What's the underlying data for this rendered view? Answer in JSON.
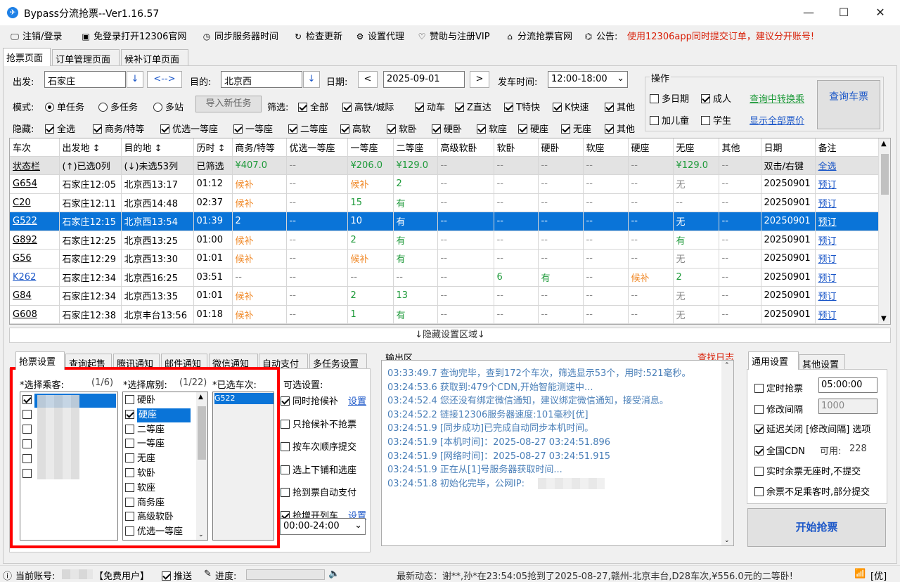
{
  "window": {
    "title": "Bypass分流抢票--Ver1.16.57",
    "app_icon_glyph": "✈"
  },
  "menu": {
    "items": [
      {
        "icon": "🖵",
        "label": "注销/登录"
      },
      {
        "icon": "▣",
        "label": "免登录打开12306官网"
      },
      {
        "icon": "◷",
        "label": "同步服务器时间"
      },
      {
        "icon": "↻",
        "label": "检查更新"
      },
      {
        "icon": "⚙",
        "label": "设置代理"
      },
      {
        "icon": "♡",
        "label": "赞助与注册VIP"
      },
      {
        "icon": "⌂",
        "label": "分流抢票官网"
      },
      {
        "icon": "⌬",
        "label": "公告:"
      }
    ],
    "notice": "使用12306app同时提交订单，建议分开账号!"
  },
  "top_tabs": [
    "抢票页面",
    "订单管理页面",
    "候补订单页面"
  ],
  "query": {
    "from_label": "出发:",
    "from_value": "石家庄",
    "swap_label": "<-->",
    "to_label": "目的:",
    "to_value": "北京西",
    "date_label": "日期:",
    "date_value": "2025-09-01",
    "prev": "<",
    "next": ">",
    "time_label": "发车时间:",
    "time_value": "12:00-18:00",
    "mode_label": "模式:",
    "modes": [
      {
        "label": "单任务",
        "on": true
      },
      {
        "label": "多任务",
        "on": false
      },
      {
        "label": "多站",
        "on": false
      }
    ],
    "import_btn": "导入新任务",
    "filter_label": "筛选:",
    "filters": [
      {
        "label": "全部",
        "on": true
      },
      {
        "label": "高铁/城际",
        "on": true
      },
      {
        "label": "动车",
        "on": true
      },
      {
        "label": "Z直达",
        "on": true
      },
      {
        "label": "T特快",
        "on": true
      },
      {
        "label": "K快速",
        "on": true
      },
      {
        "label": "其他",
        "on": true
      }
    ],
    "hide_label": "隐藏:",
    "hides": [
      {
        "label": "全选",
        "on": true
      },
      {
        "label": "商务/特等",
        "on": true
      },
      {
        "label": "优选一等座",
        "on": true
      },
      {
        "label": "一等座",
        "on": true
      },
      {
        "label": "二等座",
        "on": true
      },
      {
        "label": "高软",
        "on": true
      },
      {
        "label": "软卧",
        "on": true
      },
      {
        "label": "硬卧",
        "on": true
      },
      {
        "label": "软座",
        "on": true
      },
      {
        "label": "硬座",
        "on": true
      },
      {
        "label": "无座",
        "on": true
      },
      {
        "label": "其他",
        "on": true
      }
    ]
  },
  "ops": {
    "title": "操作",
    "multi_day": "多日期",
    "adult": "成人",
    "child": "加儿童",
    "student": "学生",
    "transfer_link": "查询中转换乘",
    "all_price_link": "显示全部票价",
    "query_btn": "查询车票"
  },
  "table": {
    "headers": [
      "车次",
      "出发地 ↕",
      "目的地 ↕",
      "历时 ↕",
      "商务/特等",
      "优选一等座",
      "一等座",
      "二等座",
      "高级软卧",
      "软卧",
      "硬卧",
      "软座",
      "硬座",
      "无座",
      "其他",
      "日期",
      "备注"
    ],
    "status_row": [
      "状态栏",
      "(↑)已选0列",
      "(↓)未选53列",
      "已筛选",
      "¥407.0",
      "--",
      "¥206.0",
      "¥129.0",
      "--",
      "--",
      "--",
      "--",
      "--",
      "¥129.0",
      "--",
      "双击/右键",
      "全选"
    ],
    "rows": [
      [
        "G654",
        "石家庄12:05",
        "北京西13:17",
        "01:12",
        "候补",
        "--",
        "候补",
        "2",
        "--",
        "--",
        "--",
        "--",
        "--",
        "无",
        "--",
        "20250901",
        "预订"
      ],
      [
        "C20",
        "石家庄12:11",
        "北京西14:48",
        "02:37",
        "候补",
        "--",
        "15",
        "有",
        "--",
        "--",
        "--",
        "--",
        "--",
        "--",
        "--",
        "20250901",
        "预订"
      ],
      [
        "G522",
        "石家庄12:15",
        "北京西13:54",
        "01:39",
        "2",
        "--",
        "10",
        "有",
        "--",
        "--",
        "--",
        "--",
        "--",
        "无",
        "--",
        "20250901",
        "预订"
      ],
      [
        "G892",
        "石家庄12:25",
        "北京西13:25",
        "01:00",
        "候补",
        "--",
        "2",
        "有",
        "--",
        "--",
        "--",
        "--",
        "--",
        "有",
        "--",
        "20250901",
        "预订"
      ],
      [
        "G56",
        "石家庄12:29",
        "北京西13:30",
        "01:01",
        "候补",
        "--",
        "候补",
        "有",
        "--",
        "--",
        "--",
        "--",
        "--",
        "无",
        "--",
        "20250901",
        "预订"
      ],
      [
        "K262",
        "石家庄12:34",
        "北京西16:25",
        "03:51",
        "--",
        "--",
        "--",
        "--",
        "--",
        "6",
        "有",
        "--",
        "候补",
        "2",
        "--",
        "20250901",
        "预订"
      ],
      [
        "G84",
        "石家庄12:34",
        "北京西13:35",
        "01:01",
        "候补",
        "--",
        "2",
        "13",
        "--",
        "--",
        "--",
        "--",
        "--",
        "无",
        "--",
        "20250901",
        "预订"
      ],
      [
        "G608",
        "石家庄12:38",
        "北京丰台13:56",
        "01:18",
        "候补",
        "--",
        "1",
        "有",
        "--",
        "--",
        "--",
        "--",
        "--",
        "无",
        "--",
        "20250901",
        "预订"
      ]
    ],
    "selected_row": 2
  },
  "hidden_area": "↓隐藏设置区域↓",
  "bottom_tabs": [
    "抢票设置",
    "查询起售",
    "腾讯通知",
    "邮件通知",
    "微信通知",
    "自动支付",
    "多任务设置"
  ],
  "passenger": {
    "label": "*选择乘客:",
    "count": "(1/6)"
  },
  "seat": {
    "label": "*选择席别:",
    "count": "(1/22)",
    "items": [
      {
        "label": "硬卧",
        "on": false
      },
      {
        "label": "硬座",
        "on": true
      },
      {
        "label": "二等座",
        "on": false
      },
      {
        "label": "一等座",
        "on": false
      },
      {
        "label": "无座",
        "on": false
      },
      {
        "label": "软卧",
        "on": false
      },
      {
        "label": "软座",
        "on": false
      },
      {
        "label": "商务座",
        "on": false
      },
      {
        "label": "高级软卧",
        "on": false
      },
      {
        "label": "优选一等座",
        "on": false
      }
    ]
  },
  "train_sel": {
    "label": "*已选车次:",
    "items": [
      "G522"
    ]
  },
  "options": {
    "label": "可选设置:",
    "items": [
      {
        "label": "同时抢候补",
        "on": true,
        "link": "设置"
      },
      {
        "label": "只抢候补不抢票",
        "on": false,
        "link": ""
      },
      {
        "label": "按车次顺序提交",
        "on": false,
        "link": ""
      },
      {
        "label": "选上下铺和选座",
        "on": false,
        "link": ""
      },
      {
        "label": "抢到票自动支付",
        "on": false,
        "link": ""
      },
      {
        "label": "抢增开列车",
        "on": true,
        "link": "设置"
      }
    ],
    "time_range": "00:00-24:00"
  },
  "output": {
    "label": "输出区",
    "find_log": "查找日志",
    "lines": [
      "03:33:49.7  查询完毕，查到172个车次，筛选显示53个，用时:521毫秒。",
      "03:24:53.6  获取到:479个CDN,开始智能测速中...",
      "03:24:52.4  您还没有绑定微信通知，建议绑定微信通知，接受消息。",
      "03:24:52.2  链接12306服务器速度:101毫秒[优]",
      "03:24:51.9  [同步成功]已完成自动同步本机时间。",
      "03:24:51.9  [本机时间]：2025-08-27 03:24:51.896",
      "03:24:51.9  [网络时间]：2025-08-27 03:24:51.915",
      "03:24:51.9  正在从[1]号服务器获取时间...",
      "03:24:51.8  初始化完毕，公网IP:"
    ]
  },
  "general": {
    "tabs": [
      "通用设置",
      "其他设置"
    ],
    "timed": "定时抢票",
    "timed_value": "05:00:00",
    "interval": "修改间隔",
    "interval_value": "1000",
    "delay_close": "延迟关闭 [修改间隔] 选项",
    "cdn": "全国CDN",
    "cdn_avail_label": "可用:",
    "cdn_avail": "228",
    "no_seat_skip": "实时余票无座时,不提交",
    "partial": "余票不足乘客时,部分提交",
    "start_btn": "开始抢票"
  },
  "status": {
    "account_label": "当前账号:",
    "user_type": "【免费用户】",
    "push": "推送",
    "progress": "进度:",
    "news": "最新动态：谢**,孙*在23:54:05抢到了2025-08-27,赣州-北京丰台,D28车次,¥556.0元的二等卧!",
    "net": "[优]"
  }
}
